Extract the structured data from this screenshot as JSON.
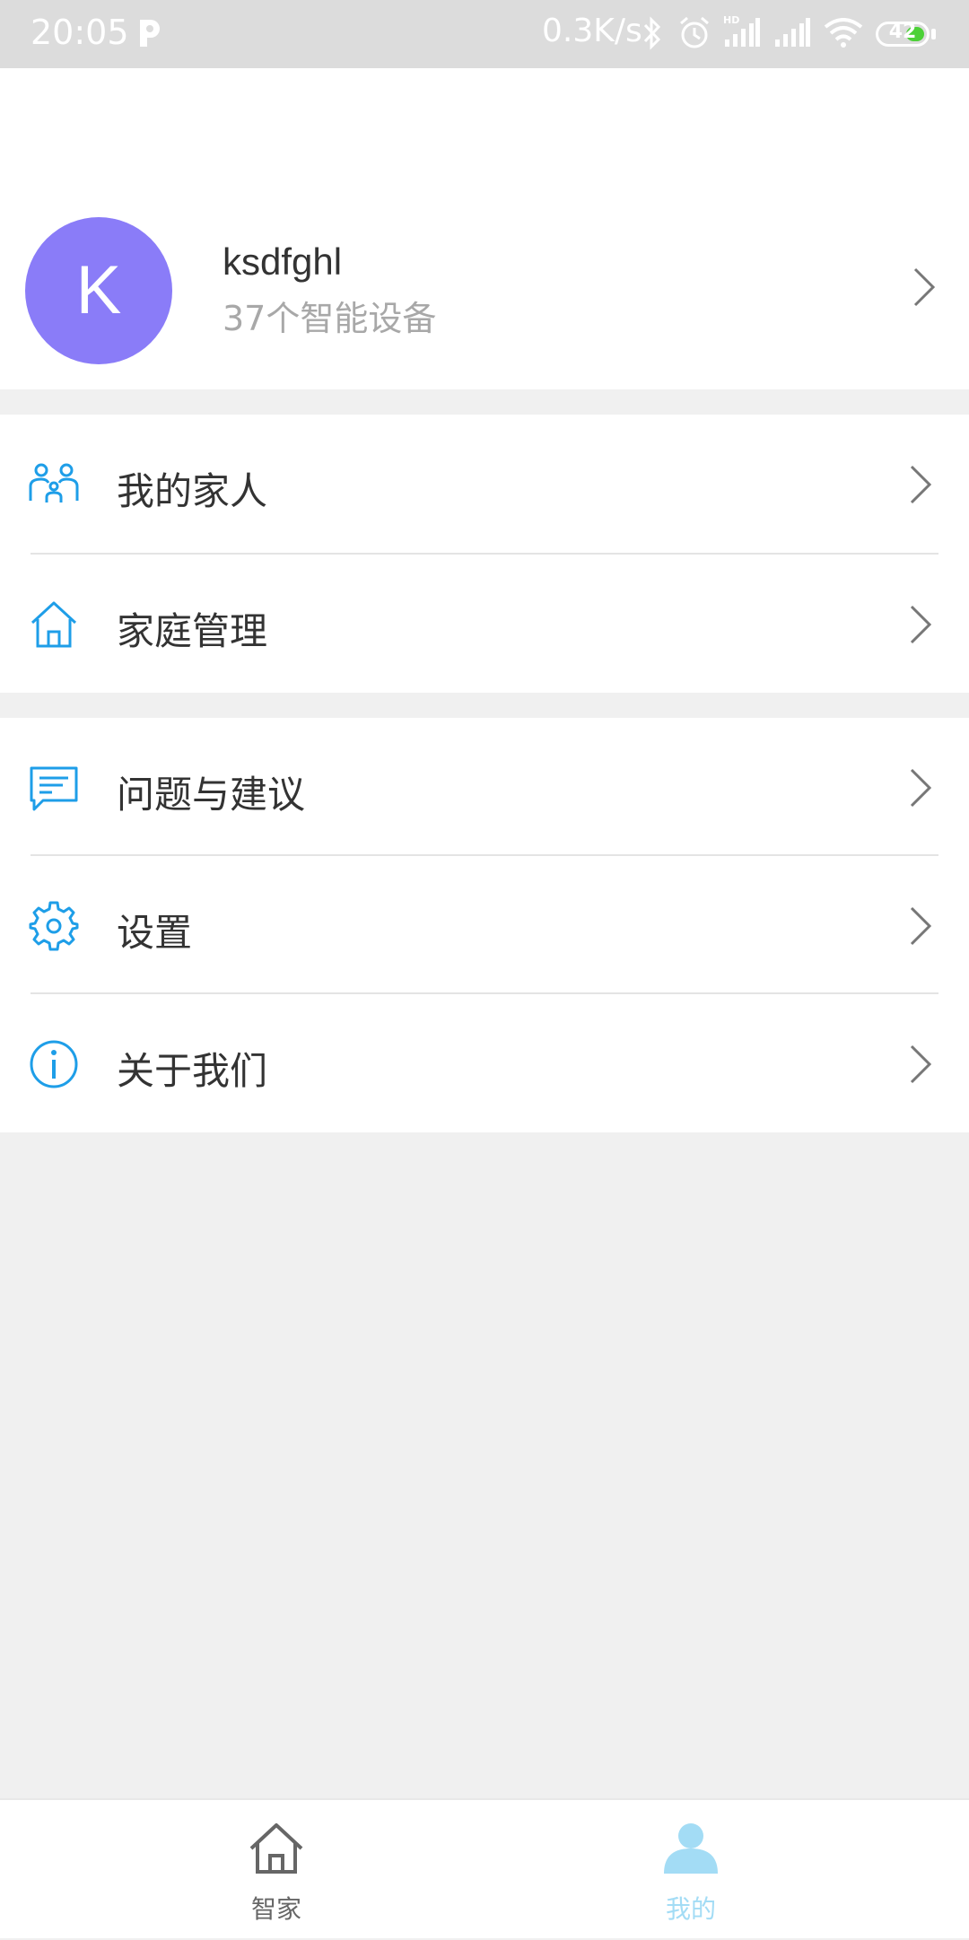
{
  "status_bar": {
    "time": "20:05",
    "network_speed": "0.3K/s",
    "battery": "42",
    "icons": [
      "p-icon",
      "bluetooth-icon",
      "alarm-icon",
      "hd-signal-icon",
      "signal-icon",
      "wifi-icon",
      "battery-icon"
    ]
  },
  "profile": {
    "avatar_letter": "K",
    "avatar_color": "#8a7cf8",
    "username": "ksdfghl",
    "device_count": "37个智能设备"
  },
  "menu_group_1": [
    {
      "label": "我的家人",
      "icon": "family-icon"
    },
    {
      "label": "家庭管理",
      "icon": "home-icon"
    }
  ],
  "menu_group_2": [
    {
      "label": "问题与建议",
      "icon": "message-icon"
    },
    {
      "label": "设置",
      "icon": "gear-icon"
    },
    {
      "label": "关于我们",
      "icon": "info-icon"
    }
  ],
  "tab_bar": {
    "tabs": [
      {
        "label": "智家",
        "icon": "home-icon",
        "active": false
      },
      {
        "label": "我的",
        "icon": "person-icon",
        "active": true
      }
    ]
  },
  "colors": {
    "accent_blue": "#1e9ee8",
    "active_tab": "#a3dcf5",
    "inactive_tab": "#666666"
  }
}
